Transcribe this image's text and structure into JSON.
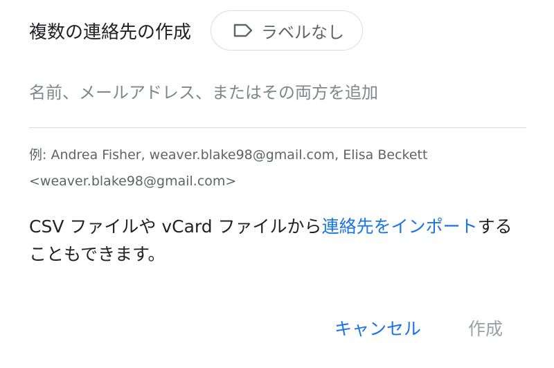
{
  "dialog": {
    "title": "複数の連絡先の作成",
    "label_chip": {
      "icon": "label-icon",
      "text": "ラベルなし"
    },
    "input": {
      "value": "",
      "placeholder": "名前、メールアドレス、またはその両方を追加"
    },
    "example_text": "例: Andrea Fisher, weaver.blake98@gmail.com, Elisa Beckett <weaver.blake98@gmail.com>",
    "import_prefix": "CSV ファイルや vCard ファイルから",
    "import_link": "連絡先をインポート",
    "import_suffix": "することもできます。",
    "buttons": {
      "cancel": "キャンセル",
      "create": "作成"
    },
    "colors": {
      "accent": "#1a73e8",
      "disabled": "#9aa0a6",
      "secondary_text": "#5f6368",
      "divider": "#dadce0"
    }
  }
}
